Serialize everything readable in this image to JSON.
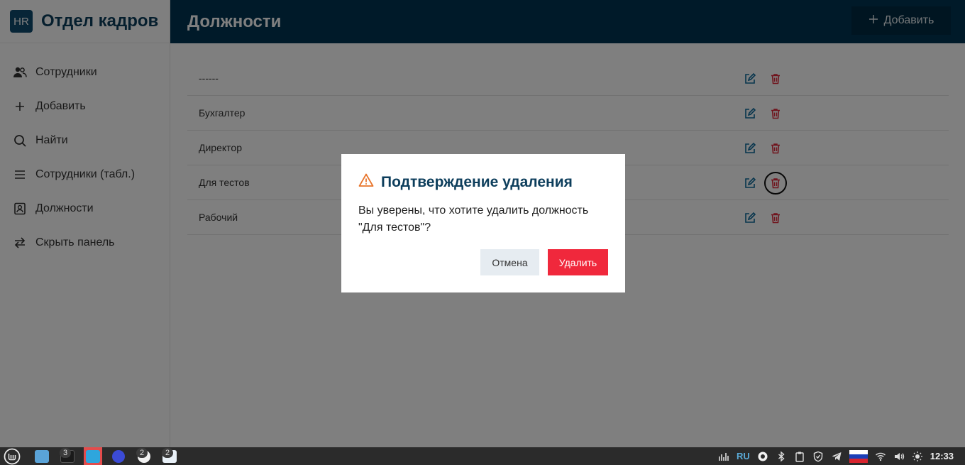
{
  "sidebar": {
    "badge": "HR",
    "title": "Отдел кадров",
    "items": [
      {
        "label": "Сотрудники",
        "icon": "users-icon"
      },
      {
        "label": "Добавить",
        "icon": "plus-icon"
      },
      {
        "label": "Найти",
        "icon": "search-icon"
      },
      {
        "label": "Сотрудники (табл.)",
        "icon": "list-icon"
      },
      {
        "label": "Должности",
        "icon": "id-badge-icon"
      },
      {
        "label": "Скрыть панель",
        "icon": "swap-arrows-icon"
      }
    ]
  },
  "header": {
    "title": "Должности",
    "add_label": "Добавить"
  },
  "positions": [
    {
      "name": "------"
    },
    {
      "name": "Бухгалтер"
    },
    {
      "name": "Директор"
    },
    {
      "name": "Для тестов"
    },
    {
      "name": "Рабочий"
    }
  ],
  "modal": {
    "title": "Подтверждение удаления",
    "message": "Вы уверены, что хотите удалить должность \"Для тестов\"?",
    "cancel_label": "Отмена",
    "delete_label": "Удалить"
  },
  "taskbar": {
    "apps": [
      {
        "icon": "folder-icon",
        "badge": ""
      },
      {
        "icon": "terminal-icon",
        "badge": "3"
      },
      {
        "icon": "telegram-icon",
        "badge": ""
      },
      {
        "icon": "chat-icon",
        "badge": ""
      },
      {
        "icon": "browser-icon",
        "badge": "2"
      },
      {
        "icon": "editor-icon",
        "badge": "2"
      }
    ],
    "lang": "RU",
    "time": "12:33"
  },
  "colors": {
    "header_bg": "#003552",
    "brand": "#0d3e5c",
    "edit_icon": "#0e6a9a",
    "delete_icon": "#e0283a",
    "delete_button": "#f0283c",
    "warning": "#e8742a"
  }
}
